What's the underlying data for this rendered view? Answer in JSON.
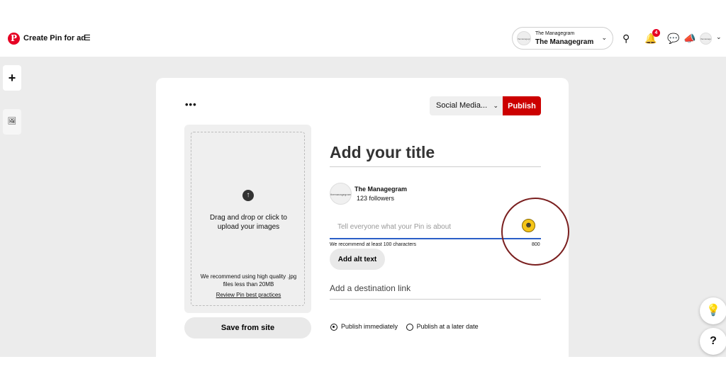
{
  "header": {
    "logo_letter": "P",
    "title": "Create Pin for ad",
    "menu_icon": "hamburger-icon",
    "account": {
      "avatar_text": "themanagegram",
      "small_name": "The Managegram",
      "name": "The Managegram"
    },
    "notification_count": "4",
    "icons": [
      "search-icon",
      "bell-icon",
      "chat-icon",
      "megaphone-icon",
      "avatar",
      "chevron-down-icon"
    ]
  },
  "sidebar": {
    "add_label": "+",
    "image_icon": "image-icon"
  },
  "toolbar": {
    "more_label": "•••",
    "board_select": "Social Media...",
    "publish_label": "Publish"
  },
  "upload": {
    "instruction": "Drag and drop or click to upload your images",
    "recommendation": "We recommend using high quality .jpg files less than 20MB",
    "best_practices_link": "Review Pin best practices",
    "save_from_site": "Save from site"
  },
  "form": {
    "title_placeholder": "Add your title",
    "user_name": "The Managegram",
    "followers": "123 followers",
    "description_placeholder": "Tell everyone what your Pin is about",
    "recommend_text": "We recommend at least 100 characters",
    "char_count": "800",
    "alt_text_button": "Add alt text",
    "destination_placeholder": "Add a destination link",
    "publish_options": {
      "immediately": "Publish immediately",
      "later": "Publish at a later date",
      "selected": "immediately"
    }
  },
  "floating": {
    "tips_icon": "lightbulb-icon",
    "help_label": "?"
  },
  "colors": {
    "brand_red": "#e60023",
    "publish_red": "#cc0000",
    "focus_blue": "#2b5fc7",
    "annotation": "#7a1f1f"
  }
}
